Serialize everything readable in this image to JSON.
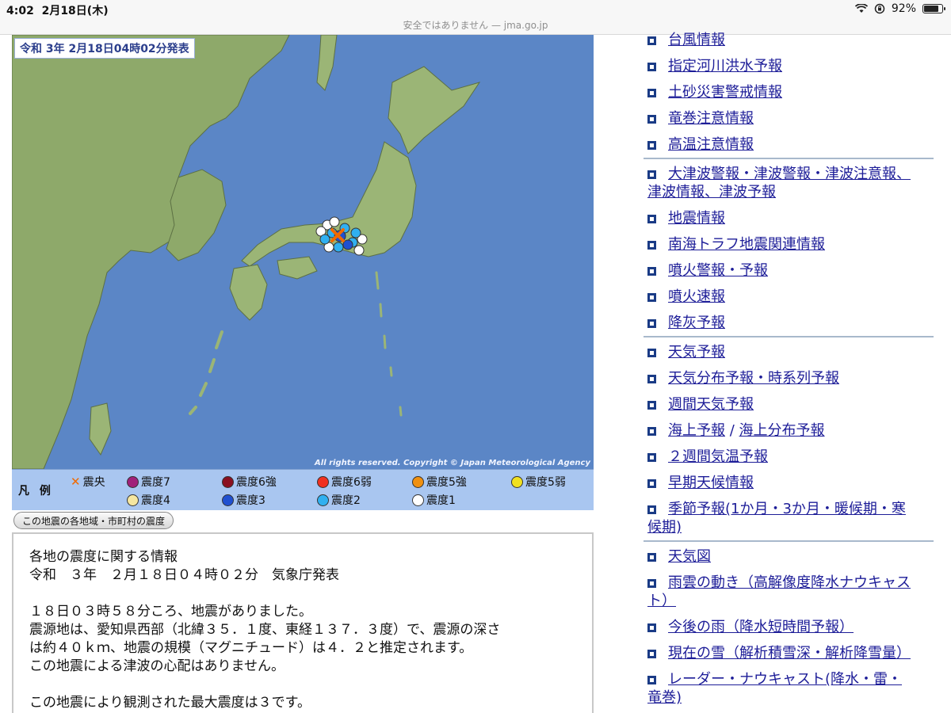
{
  "status": {
    "time": "4:02",
    "date": "2月18日(木)",
    "battery": "92%",
    "battery_level": 0.92
  },
  "url_bar": {
    "text": "安全ではありません — jma.go.jp"
  },
  "map": {
    "title": "令和 3年 2月18日04時02分発表",
    "copyright": "All rights reserved. Copyright © Japan Meteorological Agency"
  },
  "legend": {
    "heading": "凡 例",
    "epicenter_label": "震央",
    "items": [
      {
        "label": "震度7",
        "color": "#a0207a"
      },
      {
        "label": "震度6強",
        "color": "#8a1020"
      },
      {
        "label": "震度6弱",
        "color": "#f03020"
      },
      {
        "label": "震度5強",
        "color": "#f09010"
      },
      {
        "label": "震度5弱",
        "color": "#f0e020"
      },
      {
        "label": "震度4",
        "color": "#f5e6a0"
      },
      {
        "label": "震度3",
        "color": "#2050d0"
      },
      {
        "label": "震度2",
        "color": "#30b0f0"
      },
      {
        "label": "震度1",
        "color": "#ffffff"
      }
    ]
  },
  "region_button": {
    "label": "この地震の各地域・市町村の震度"
  },
  "info": {
    "lines": [
      "各地の震度に関する情報",
      "令和　３年　２月１８日０４時０２分　気象庁発表",
      "",
      "１８日０３時５８分ころ、地震がありました。",
      "震源地は、愛知県西部（北緯３５．１度、東経１３７．３度）で、震源の深さ",
      "は約４０ｋｍ、地震の規模（マグニチュード）は４．２と推定されます。",
      "この地震による津波の心配はありません。",
      "",
      "この地震により観測された最大震度は３です。"
    ]
  },
  "nav": {
    "group1": [
      "台風情報",
      "指定河川洪水予報",
      "土砂災害警戒情報",
      "竜巻注意情報",
      "高温注意情報"
    ],
    "group2_wrap": {
      "first": "大津波警報・津波警報・津波注意報、",
      "rest": "津波情報、津波予報"
    },
    "group2": [
      "地震情報",
      "南海トラフ地震関連情報",
      "噴火警報・予報",
      "噴火速報",
      "降灰予報"
    ],
    "group3": [
      "天気予報",
      "天気分布予報・時系列予報",
      "週間天気予報"
    ],
    "marine": {
      "a": "海上予報",
      "sep": "/",
      "b": "海上分布予報"
    },
    "group3b": [
      "２週間気温予報",
      "早期天候情報"
    ],
    "seasonal": {
      "first": "季節予報(1か月・3か月・暖候期・寒",
      "rest": "候期)"
    },
    "group4": [
      "天気図"
    ],
    "rain": {
      "first": "雨雲の動き（高解像度降水ナウキャス",
      "rest": "ト）"
    },
    "group4b": [
      "今後の雨（降水短時間予報）",
      "現在の雪（解析積雪深・解析降雪量）"
    ],
    "radar": {
      "first": "レーダー・ナウキャスト(降水・雷・",
      "rest": "竜巻)"
    }
  },
  "colors": {
    "sea": "#5b86c6",
    "land": "#8ea96a",
    "link": "#1d1d98",
    "accent": "#f06a00"
  }
}
